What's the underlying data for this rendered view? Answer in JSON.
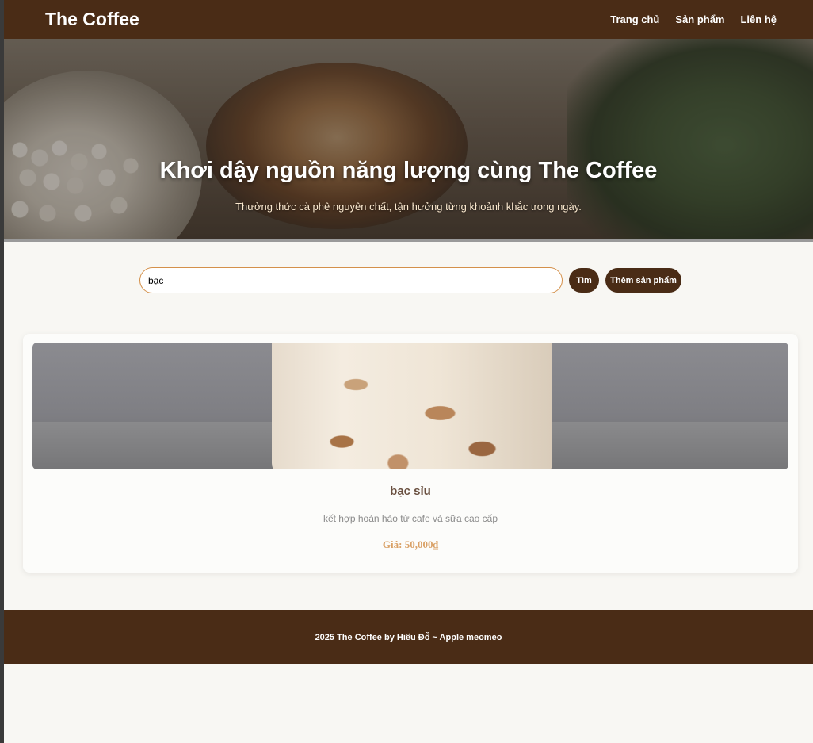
{
  "header": {
    "logo": "The Coffee",
    "nav": [
      "Trang chủ",
      "Sản phẩm",
      "Liên hệ"
    ]
  },
  "hero": {
    "title": "Khơi dậy nguồn năng lượng cùng The Coffee",
    "subtitle": "Thưởng thức cà phê nguyên chất, tận hưởng từng khoảnh khắc trong ngày."
  },
  "search": {
    "value": "bạc",
    "find_label": "Tìm",
    "add_label": "Thêm sản phẩm"
  },
  "products": [
    {
      "name": "bạc sỉu",
      "description": "kết hợp hoàn hảo từ cafe và sữa cao cấp",
      "price": "Giá: 50,000₫"
    }
  ],
  "footer": {
    "text": "2025 The Coffee by Hiếu Đỗ ~ Apple meomeo"
  },
  "colors": {
    "brand_brown": "#4a2c16",
    "price": "#d9a065"
  }
}
